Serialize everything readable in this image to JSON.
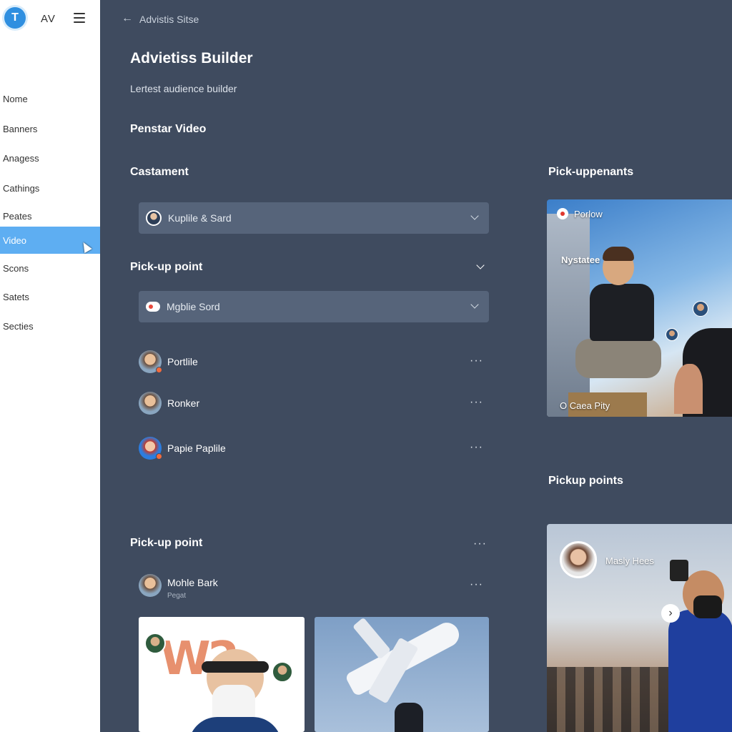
{
  "sidebar": {
    "logo_letter": "T",
    "brand": "AV",
    "items": [
      {
        "label": "Nome"
      },
      {
        "label": "Banners"
      },
      {
        "label": "Anagess"
      },
      {
        "label": "Cathings"
      },
      {
        "label": "Peates"
      },
      {
        "label": "Video"
      },
      {
        "label": "Scons"
      },
      {
        "label": "Satets"
      },
      {
        "label": "Secties"
      }
    ],
    "active_index": 5
  },
  "header": {
    "breadcrumb": "Advistis Sitse",
    "title": "Advietiss Builder",
    "subtitle": "Lertest audience builder"
  },
  "main": {
    "section_video": "Penstar Video",
    "section_castament": "Castament",
    "select_1": "Kuplile & Sard",
    "section_pickup": "Pick-up point",
    "select_2": "Mgblie Sord",
    "list": [
      {
        "name": "Portlile"
      },
      {
        "name": "Ronker"
      },
      {
        "name": "Papie Paplile"
      }
    ],
    "section_pickup_2": "Pick-up point",
    "row": {
      "name": "Mohle Bark",
      "sub": "Pegat"
    },
    "card_text": "W2"
  },
  "right": {
    "section_1": "Pick-uppenants",
    "photo_1": {
      "tag": "Porlow",
      "label": "Nystatee",
      "caption": "O Caea Pity"
    },
    "section_2": "Pickup points",
    "photo_2": {
      "name": "Masly Hees"
    }
  },
  "icons": {
    "more": "···",
    "back": "←",
    "next": "›"
  },
  "colors": {
    "accent": "#5eaef2",
    "background": "#3f4b5f",
    "field": "#56647a"
  }
}
